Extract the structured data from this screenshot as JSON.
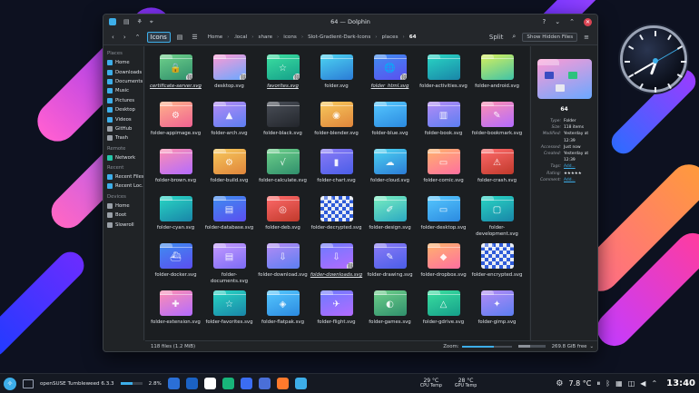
{
  "window": {
    "title": "64 — Dolphin",
    "menu_icons": [
      "app-icon",
      "menu-icon",
      "filter-icon",
      "pin-icon"
    ]
  },
  "toolbar": {
    "back": "‹",
    "forward": "›",
    "up": "⌃",
    "view_icons": "Icons",
    "view_details": "☰",
    "view_compact": "▤",
    "split": "Split",
    "search": "⌕",
    "show_hidden": "Show Hidden Files",
    "menu": "≡"
  },
  "breadcrumb": [
    "Home",
    ".local",
    "share",
    "icons",
    "Slot-Gradient-Dark-Icons",
    "places",
    "64"
  ],
  "sidebar": {
    "sections": [
      {
        "title": "Places",
        "items": [
          {
            "label": "Home",
            "icon": "home-icon"
          },
          {
            "label": "Downloads",
            "icon": "download-icon"
          },
          {
            "label": "Documents",
            "icon": "document-icon"
          },
          {
            "label": "Music",
            "icon": "music-icon"
          },
          {
            "label": "Pictures",
            "icon": "picture-icon"
          },
          {
            "label": "Desktop",
            "icon": "desktop-icon"
          },
          {
            "label": "Videos",
            "icon": "video-icon"
          },
          {
            "label": "GitHub",
            "icon": "github-icon"
          },
          {
            "label": "Trash",
            "icon": "trash-icon"
          }
        ]
      },
      {
        "title": "Remote",
        "items": [
          {
            "label": "Network",
            "icon": "network-icon"
          }
        ]
      },
      {
        "title": "Recent",
        "items": [
          {
            "label": "Recent Files",
            "icon": "recent-files-icon"
          },
          {
            "label": "Recent Loc...",
            "icon": "recent-locations-icon"
          }
        ]
      },
      {
        "title": "Devices",
        "items": [
          {
            "label": "Home",
            "icon": "drive-icon"
          },
          {
            "label": "Boot",
            "icon": "drive-icon"
          },
          {
            "label": "Slowroll",
            "icon": "drive-icon"
          }
        ]
      }
    ]
  },
  "files": [
    {
      "name": "certificate-server.svg",
      "color": "c-lime",
      "glyph": "🔒",
      "link": true,
      "italic": true
    },
    {
      "name": "desktop.svg",
      "color": "c-pink",
      "glyph": "",
      "link": true,
      "italic": false
    },
    {
      "name": "favorites.svg",
      "color": "c-green",
      "glyph": "☆",
      "link": true,
      "italic": true
    },
    {
      "name": "folder.svg",
      "color": "c-cyan",
      "glyph": "",
      "link": false,
      "italic": false
    },
    {
      "name": "folder_html.svg",
      "color": "c-blue",
      "glyph": "🌐",
      "link": true,
      "italic": true
    },
    {
      "name": "folder-activities.svg",
      "color": "c-teal",
      "glyph": "",
      "link": false,
      "italic": false
    },
    {
      "name": "folder-android.svg",
      "color": "c-yellow",
      "glyph": "",
      "link": false,
      "italic": false
    },
    {
      "name": "folder-appimage.svg",
      "color": "c-peach",
      "glyph": "⚙",
      "link": false,
      "italic": false
    },
    {
      "name": "folder-arch.svg",
      "color": "c-violet",
      "glyph": "▲",
      "link": false,
      "italic": false
    },
    {
      "name": "folder-black.svg",
      "color": "c-black",
      "glyph": "",
      "link": false,
      "italic": false
    },
    {
      "name": "folder-blender.svg",
      "color": "c-amber",
      "glyph": "◉",
      "link": false,
      "italic": false
    },
    {
      "name": "folder-blue.svg",
      "color": "c-sky",
      "glyph": "",
      "link": false,
      "italic": false
    },
    {
      "name": "folder-book.svg",
      "color": "c-violet",
      "glyph": "▥",
      "link": false,
      "italic": false
    },
    {
      "name": "folder-bookmark.svg",
      "color": "c-rose",
      "glyph": "✎",
      "link": false,
      "italic": false
    },
    {
      "name": "folder-brown.svg",
      "color": "c-rose",
      "glyph": "",
      "link": false,
      "italic": false
    },
    {
      "name": "folder-build.svg",
      "color": "c-amber",
      "glyph": "⚙",
      "link": false,
      "italic": false
    },
    {
      "name": "folder-calculate.svg",
      "color": "c-lime",
      "glyph": "√",
      "link": false,
      "italic": false
    },
    {
      "name": "folder-chart.svg",
      "color": "c-purple",
      "glyph": "▮",
      "link": false,
      "italic": false
    },
    {
      "name": "folder-cloud.svg",
      "color": "c-cyan",
      "glyph": "☁",
      "link": false,
      "italic": false
    },
    {
      "name": "folder-comic.svg",
      "color": "c-orange",
      "glyph": "▭",
      "link": false,
      "italic": false
    },
    {
      "name": "folder-crash.svg",
      "color": "c-red",
      "glyph": "⚠",
      "link": false,
      "italic": false
    },
    {
      "name": "folder-cyan.svg",
      "color": "c-teal",
      "glyph": "",
      "link": false,
      "italic": false
    },
    {
      "name": "folder-database.svg",
      "color": "c-blue",
      "glyph": "▤",
      "link": false,
      "italic": false
    },
    {
      "name": "folder-deb.svg",
      "color": "c-red",
      "glyph": "◎",
      "link": false,
      "italic": false
    },
    {
      "name": "folder-decrypted.svg",
      "color": "c-check",
      "glyph": "",
      "link": false,
      "italic": false
    },
    {
      "name": "folder-design.svg",
      "color": "c-mint",
      "glyph": "✐",
      "link": false,
      "italic": false
    },
    {
      "name": "folder-desktop.svg",
      "color": "c-sky",
      "glyph": "▭",
      "link": false,
      "italic": false
    },
    {
      "name": "folder-development.svg",
      "color": "c-teal",
      "glyph": "▢",
      "link": false,
      "italic": false
    },
    {
      "name": "folder-docker.svg",
      "color": "c-blue",
      "glyph": "⛴",
      "link": false,
      "italic": false
    },
    {
      "name": "folder-documents.svg",
      "color": "c-lilac",
      "glyph": "▤",
      "link": false,
      "italic": false
    },
    {
      "name": "folder-download.svg",
      "color": "c-violet",
      "glyph": "⇩",
      "link": false,
      "italic": false
    },
    {
      "name": "folder-downloads.svg",
      "color": "c-indigo",
      "glyph": "⇩",
      "link": true,
      "italic": true
    },
    {
      "name": "folder-drawing.svg",
      "color": "c-purple",
      "glyph": "✎",
      "link": false,
      "italic": false
    },
    {
      "name": "folder-dropbox.svg",
      "color": "c-orange",
      "glyph": "◆",
      "link": false,
      "italic": false
    },
    {
      "name": "folder-encrypted.svg",
      "color": "c-check",
      "glyph": "",
      "link": false,
      "italic": false
    },
    {
      "name": "folder-extension.svg",
      "color": "c-rose",
      "glyph": "✚",
      "link": false,
      "italic": false
    },
    {
      "name": "folder-favorites.svg",
      "color": "c-teal",
      "glyph": "☆",
      "link": false,
      "italic": false
    },
    {
      "name": "folder-flatpak.svg",
      "color": "c-sky",
      "glyph": "◈",
      "link": false,
      "italic": false
    },
    {
      "name": "folder-flight.svg",
      "color": "c-indigo",
      "glyph": "✈",
      "link": false,
      "italic": false
    },
    {
      "name": "folder-games.svg",
      "color": "c-lime",
      "glyph": "◐",
      "link": false,
      "italic": false
    },
    {
      "name": "folder-gdrive.svg",
      "color": "c-green",
      "glyph": "△",
      "link": false,
      "italic": false
    },
    {
      "name": "folder-gimp.svg",
      "color": "c-violet",
      "glyph": "✦",
      "link": false,
      "italic": false
    }
  ],
  "info_panel": {
    "name": "64",
    "rows": [
      {
        "key": "Type:",
        "value": "Folder",
        "link": false
      },
      {
        "key": "Size:",
        "value": "118 items",
        "link": false
      },
      {
        "key": "Modified:",
        "value": "Yesterday at 12:39",
        "link": false
      },
      {
        "key": "Accessed:",
        "value": "Just now",
        "link": false
      },
      {
        "key": "Created:",
        "value": "Yesterday at 12:39",
        "link": false
      },
      {
        "key": "Tags:",
        "value": "Add...",
        "link": true
      },
      {
        "key": "Rating:",
        "value": "★★★★★",
        "link": false
      },
      {
        "key": "Comment:",
        "value": "Add...",
        "link": true
      }
    ]
  },
  "status": {
    "count": "118 files (1.2 MiB)",
    "zoom_label": "Zoom:",
    "zoom_level": 0.65,
    "free_space": "269.8 GiB free",
    "free_used_fraction": 0.45
  },
  "taskbar": {
    "distro": "openSUSE Tumbleweed 6.3.3",
    "cpu_percent": "2.8%",
    "cpu_fraction": 0.03,
    "cpu_temp_value": "29 °C",
    "cpu_temp_label": "CPU Temp",
    "gpu_temp_value": "28 °C",
    "gpu_temp_label": "GPU Temp",
    "weather": "7.8 °C",
    "time": "13:40",
    "apps": [
      {
        "name": "system-monitor-app",
        "color": "#2b6fd6"
      },
      {
        "name": "thunderbird-app",
        "color": "#1b62c4"
      },
      {
        "name": "browser-app",
        "color": "#ffffff"
      },
      {
        "name": "gitkraken-app",
        "color": "#18b57a"
      },
      {
        "name": "firefox-developer-app",
        "color": "#3b6df2"
      },
      {
        "name": "kate-app",
        "color": "#4a6fd8"
      },
      {
        "name": "firefox-app",
        "color": "#ff7a2c"
      },
      {
        "name": "dolphin-app",
        "color": "#3daee9"
      }
    ]
  }
}
